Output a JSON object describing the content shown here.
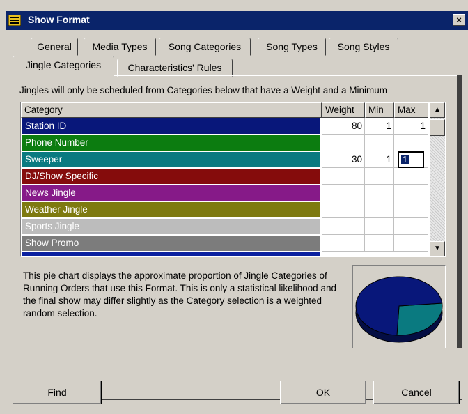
{
  "window": {
    "title": "Show Format",
    "close_label": "×"
  },
  "tabs": {
    "row1": [
      "General",
      "Media Types",
      "Song Categories",
      "Song Types",
      "Song Styles"
    ],
    "row2": [
      "Jingle Categories",
      "Characteristics' Rules"
    ]
  },
  "intro_text": "Jingles will only be scheduled from Categories below that have a Weight and a Minimum",
  "table": {
    "headers": [
      "Category",
      "Weight",
      "Min",
      "Max"
    ],
    "rows": [
      {
        "category": "Station ID",
        "color": "#08177a",
        "weight": "80",
        "min": "1",
        "max": "1"
      },
      {
        "category": "Phone Number",
        "color": "#0c7c10",
        "weight": "",
        "min": "",
        "max": ""
      },
      {
        "category": "Sweeper",
        "color": "#0a7a80",
        "weight": "30",
        "min": "1",
        "max": "1"
      },
      {
        "category": "DJ/Show Specific",
        "color": "#850c0c",
        "weight": "",
        "min": "",
        "max": ""
      },
      {
        "category": "News Jingle",
        "color": "#861a88",
        "weight": "",
        "min": "",
        "max": ""
      },
      {
        "category": "Weather Jingle",
        "color": "#7e7a10",
        "weight": "",
        "min": "",
        "max": ""
      },
      {
        "category": "Sports Jingle",
        "color": "#bcbcbc",
        "weight": "",
        "min": "",
        "max": ""
      },
      {
        "category": "Show Promo",
        "color": "#7c7c7c",
        "weight": "",
        "min": "",
        "max": ""
      }
    ],
    "editing_value": "1",
    "scroll_up": "▲",
    "scroll_down": "▼"
  },
  "description": "This pie chart displays the approximate proportion of Jingle Categories of Running Orders that use this Format. This is only a statistical likelihood and the final show may differ slightly as the Category selection is a weighted random selection.",
  "pie": {
    "slices": [
      {
        "category": "Station ID",
        "weight": 80,
        "color": "#08177a"
      },
      {
        "category": "Sweeper",
        "weight": 30,
        "color": "#0a7a80"
      }
    ]
  },
  "buttons": {
    "find": "Find",
    "ok": "OK",
    "cancel": "Cancel"
  }
}
